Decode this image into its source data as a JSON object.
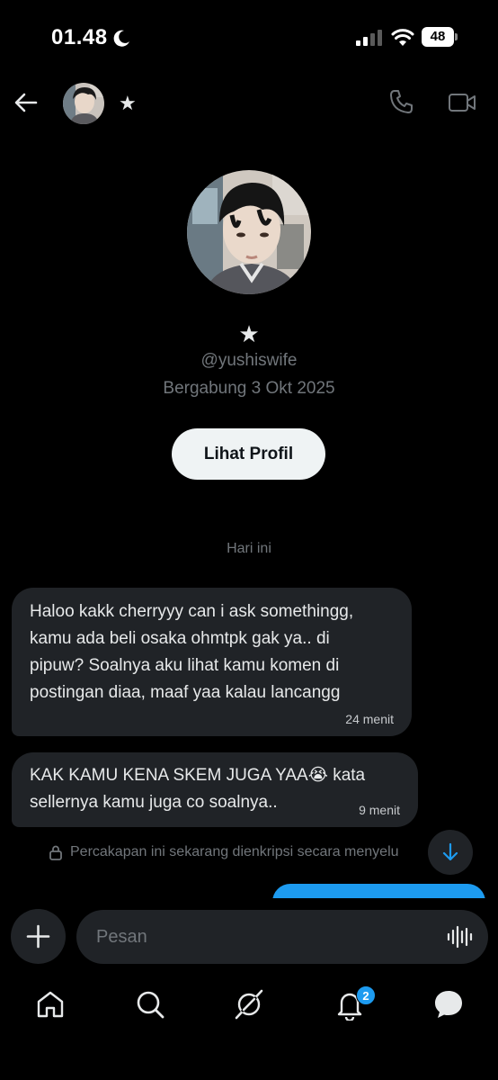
{
  "status_bar": {
    "time": "01.48",
    "battery": "48"
  },
  "header": {
    "name": "★"
  },
  "profile": {
    "name": "★",
    "handle": "@yushiswife",
    "joined": "Bergabung 3 Okt 2025",
    "view_profile_label": "Lihat Profil"
  },
  "conversation": {
    "date_separator": "Hari ini",
    "messages": [
      {
        "text": "Haloo kakk cherryyy can i ask somethingg,\nkamu ada beli osaka ohmtpk gak ya.. di\npipuw? Soalnya aku lihat kamu komen di\npostingan diaa, maaf yaa kalau lancangg",
        "time": "24 menit"
      },
      {
        "text": "KAK KAMU KENA SKEM JUGA YAA😭 kata\nsellernya kamu juga co soalnya..",
        "time": "9 menit"
      }
    ],
    "encryption_notice": "Percakapan ini sekarang dienkripsi secara menyelu"
  },
  "composer": {
    "placeholder": "Pesan"
  },
  "nav": {
    "notification_count": "2"
  },
  "colors": {
    "accent": "#1d9bf0",
    "bubble": "#202327",
    "muted": "#71767b"
  },
  "icons": [
    "moon-icon",
    "signal-icon",
    "wifi-icon",
    "back-arrow-icon",
    "phone-icon",
    "video-icon",
    "lock-icon",
    "arrow-down-icon",
    "plus-icon",
    "voice-wave-icon",
    "home-icon",
    "search-icon",
    "grok-icon",
    "bell-icon",
    "messages-icon"
  ]
}
